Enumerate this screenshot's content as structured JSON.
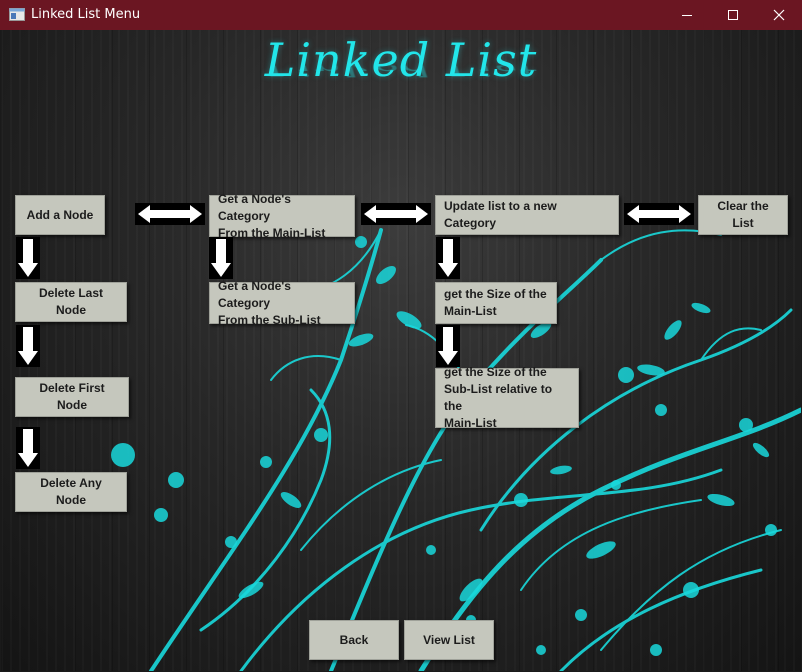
{
  "window": {
    "title": "Linked List Menu",
    "icon": "window-app-icon"
  },
  "header": {
    "title": "Linked List"
  },
  "buttons": {
    "add_node": "Add a Node",
    "delete_last": "Delete Last Node",
    "delete_first": "Delete First Node",
    "delete_any": "Delete Any Node",
    "category_main": "Get a Node's Category\nFrom the Main-List",
    "category_sub": "Get a Node's Category\nFrom the Sub-List",
    "update_category": "Update list to a new Category",
    "size_main": "get the Size of the\nMain-List",
    "size_sub": "get the Size of the\nSub-List relative to the\nMain-List",
    "clear_list": "Clear the List",
    "back": "Back",
    "view_list": "View List"
  },
  "colors": {
    "titlebar": "#6b1622",
    "accent": "#22e6ea",
    "button": "#c5c7bd"
  }
}
